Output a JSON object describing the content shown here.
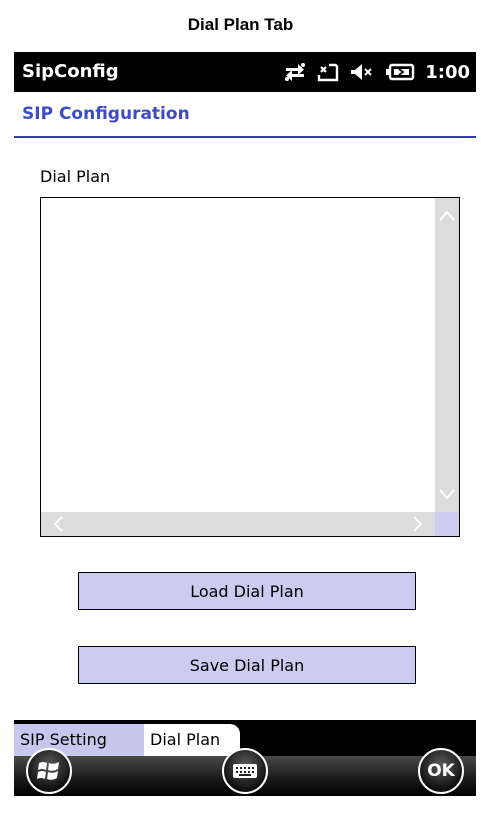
{
  "caption": "Dial Plan Tab",
  "statusbar": {
    "app_name": "SipConfig",
    "time": "1:00",
    "icons": [
      "connectivity-icon",
      "notification-icon",
      "volume-muted-icon",
      "battery-charging-icon"
    ]
  },
  "header": {
    "title": "SIP Configuration"
  },
  "dial_plan": {
    "label": "Dial Plan",
    "value": ""
  },
  "buttons": {
    "load": "Load Dial Plan",
    "save": "Save Dial Plan"
  },
  "tabs": [
    {
      "label": "SIP Setting",
      "selected": false
    },
    {
      "label": "Dial Plan",
      "selected": true
    }
  ],
  "taskbar": {
    "ok_label": "OK",
    "icons": [
      "windows-start-icon",
      "keyboard-icon"
    ]
  },
  "colors": {
    "header_text": "#3d4bc4",
    "button_bg": "#ccccf0",
    "tab_inactive_bg": "#c7c7ee"
  }
}
